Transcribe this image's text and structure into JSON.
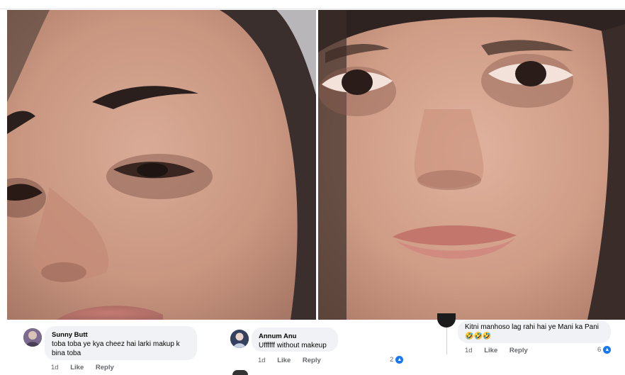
{
  "comments": [
    {
      "name": "Sunny Butt",
      "text": "toba toba ye kya cheez hai larki makup k bina toba",
      "time": "1d",
      "like": "Like",
      "reply": "Reply"
    },
    {
      "name": "Annum Anu",
      "text": "Uffffff without makeup",
      "time": "1d",
      "like": "Like",
      "reply": "Reply",
      "reactions": "2"
    },
    {
      "text": "Kitni manhoso lag rahi hai ye Mani ka Pani",
      "emoji": "🤣🤣🤣",
      "time": "1d",
      "like": "Like",
      "reply": "Reply",
      "reactions": "6"
    }
  ],
  "icons": {
    "reaction": "like-icon",
    "avatar1": "avatar-icon",
    "avatar2": "avatar-icon"
  },
  "colors": {
    "bubble": "#f0f2f5",
    "meta": "#65676b",
    "like_blue": "#1877f2"
  }
}
